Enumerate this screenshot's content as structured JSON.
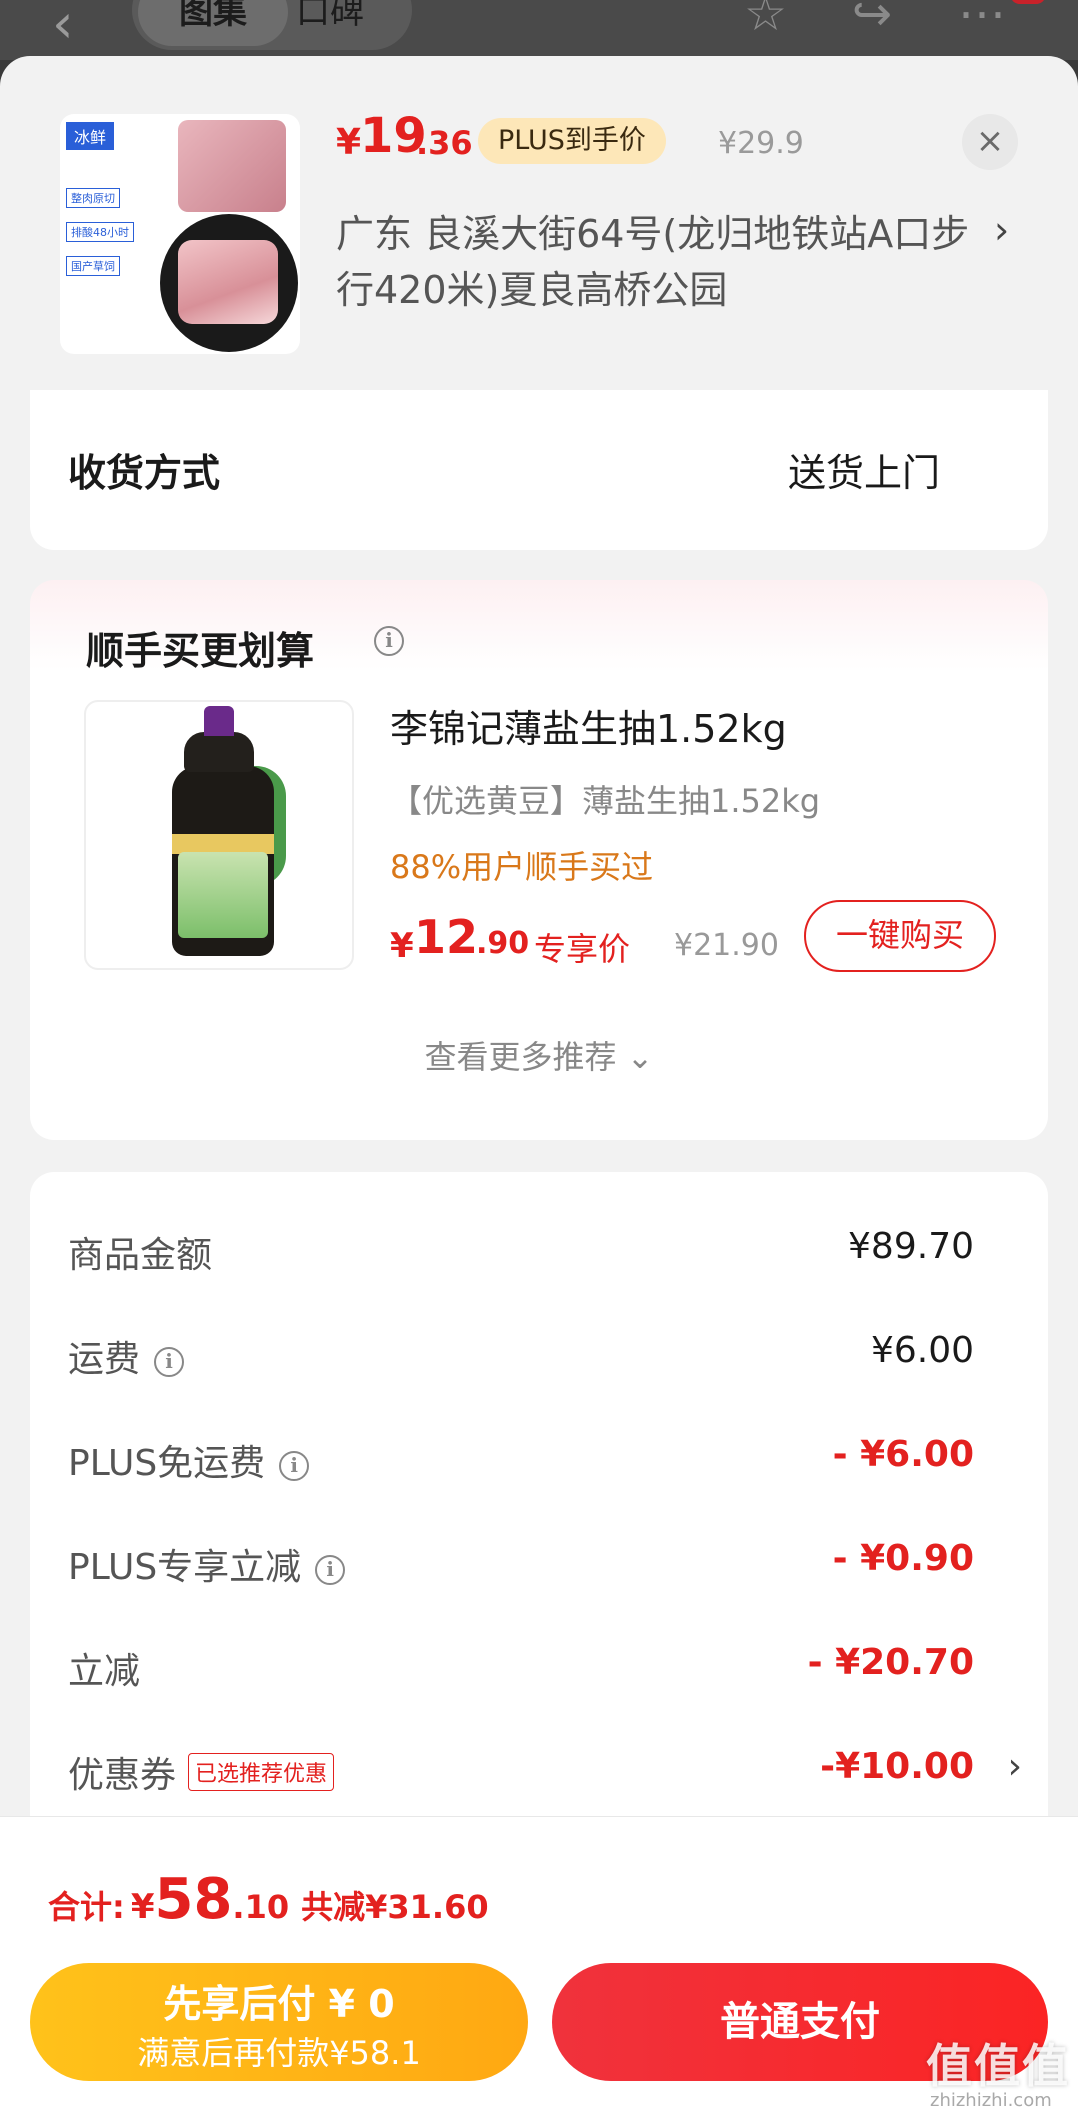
{
  "background": {
    "back_glyph": "‹",
    "tabs": [
      "图集",
      "口碑"
    ],
    "star_glyph": "☆",
    "share_glyph": "↪",
    "more_glyph": "⋯"
  },
  "product": {
    "image_tag": "冰鲜",
    "image_features": [
      "整肉原切",
      "排酸48小时",
      "国产草饲"
    ],
    "price_currency": "¥",
    "price_integer": "19",
    "price_decimal": ".36",
    "plus_tag": "PLUS到手价",
    "original_price": "¥29.9",
    "close_glyph": "×",
    "address": "广东  良溪大街64号(龙归地铁站A口步行420米)夏良高桥公园",
    "address_arrow": "›"
  },
  "delivery": {
    "label": "收货方式",
    "value": "送货上门"
  },
  "recommend": {
    "title": "顺手买更划算",
    "info_glyph": "i",
    "item": {
      "name": "李锦记薄盐生抽1.52kg",
      "desc": "【优选黄豆】薄盐生抽1.52kg",
      "stat": "88%用户顺手买过",
      "price_currency": "¥",
      "price_integer": "12",
      "price_decimal": ".90",
      "price_tag": "专享价",
      "original_price": "¥21.90",
      "buy_label": "一键购买"
    },
    "more_label": "查看更多推荐 ⌄"
  },
  "summary": {
    "rows": [
      {
        "label": "商品金额",
        "value": "¥89.70"
      },
      {
        "label": "运费",
        "value": "¥6.00"
      },
      {
        "label": "PLUS免运费",
        "value": "- ¥6.00"
      },
      {
        "label": "PLUS专享立减",
        "value": "- ¥0.90"
      },
      {
        "label": "立减",
        "value": "- ¥20.70"
      },
      {
        "label": "优惠券",
        "value": "-¥10.00",
        "tag": "已选推荐优惠",
        "arrow": "›"
      }
    ]
  },
  "footer": {
    "total_label": "合计:",
    "total_currency": "¥",
    "total_integer": "58",
    "total_decimal": ".10",
    "total_discount": "共减¥31.60",
    "pay_later_line1": "先享后付 ¥ 0",
    "pay_later_line2": "满意后再付款¥58.1",
    "pay_normal": "普通支付"
  },
  "watermark": {
    "text": "值值值",
    "sub": "zhizhizhi.com"
  },
  "colors": {
    "accent_red": "#e3211f",
    "plus_gold": "#fde7b8",
    "stat_orange": "#d9781a",
    "pay_later_yellow": "#ffb416"
  }
}
